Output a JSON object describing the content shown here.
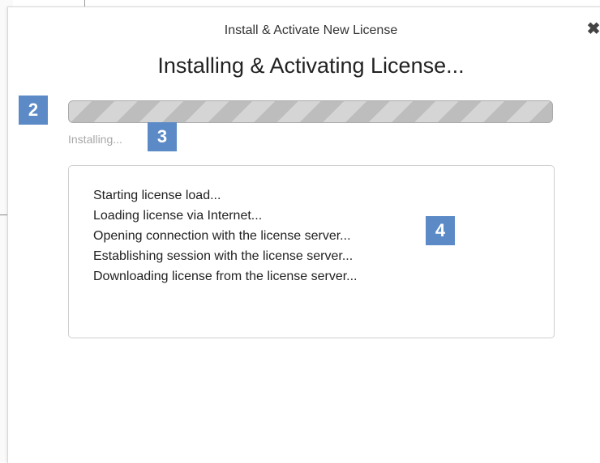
{
  "dialog": {
    "title": "Install & Activate New License",
    "heading": "Installing & Activating License...",
    "close_glyph": "✖"
  },
  "progress": {
    "percent": 100,
    "status": "Installing..."
  },
  "log": {
    "lines": [
      "Starting license load...",
      "Loading license via Internet...",
      "Opening connection with the license server...",
      "Establishing session with the license server...",
      "Downloading license from the license server..."
    ]
  },
  "callouts": {
    "c2": "2",
    "c3": "3",
    "c4": "4"
  },
  "colors": {
    "callout": "#5b8ac7",
    "progress_stripe_light": "#d5d5d5",
    "progress_stripe_dark": "#bdbdbd"
  }
}
